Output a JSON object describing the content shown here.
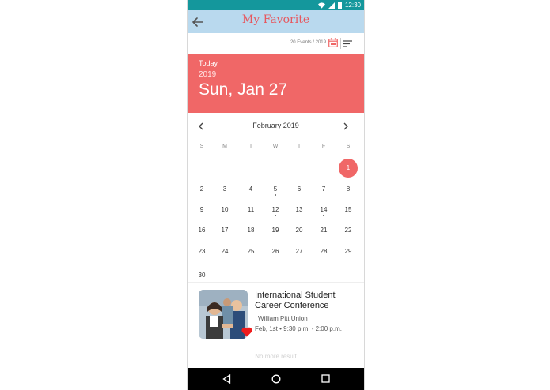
{
  "status": {
    "time": "12:30",
    "icons": [
      "wifi-icon",
      "signal-icon",
      "battery-icon"
    ]
  },
  "appbar": {
    "title": "My Favorite",
    "back_icon": "back-arrow-icon"
  },
  "toolbar": {
    "event_count": "20 Events / 2019",
    "calendar_icon": "calendar-icon",
    "menu_icon": "sort-menu-icon"
  },
  "today": {
    "label": "Today",
    "year": "2019",
    "date": "Sun, Jan 27"
  },
  "calendar": {
    "month_title": "February 2019",
    "weekdays": [
      "S",
      "M",
      "T",
      "W",
      "T",
      "F",
      "S"
    ],
    "weeks": [
      [
        "",
        "",
        "",
        "",
        "",
        "",
        "1"
      ],
      [
        "2",
        "3",
        "4",
        "5",
        "6",
        "7",
        "8"
      ],
      [
        "9",
        "10",
        "11",
        "12",
        "13",
        "14",
        "15"
      ],
      [
        "16",
        "17",
        "18",
        "19",
        "20",
        "21",
        "22"
      ],
      [
        "23",
        "24",
        "25",
        "26",
        "27",
        "28",
        "29"
      ],
      [
        "30",
        "",
        "",
        "",
        "",
        "",
        ""
      ]
    ],
    "selected_day": "1",
    "event_days": [
      "5",
      "12",
      "14"
    ]
  },
  "event": {
    "title": "International Student Career Conference",
    "place": "William Pitt Union",
    "time": "Feb, 1st • 9:30 p.m. - 2:00 p.m.",
    "favorite_icon": "heart-icon"
  },
  "list_footer": "No more result",
  "navbar": {
    "icons": [
      "nav-back-icon",
      "nav-home-icon",
      "nav-recents-icon"
    ]
  },
  "colors": {
    "status": "#14979c",
    "appbar": "#b9d9ee",
    "title": "#e7575e",
    "accent": "#f06767"
  }
}
